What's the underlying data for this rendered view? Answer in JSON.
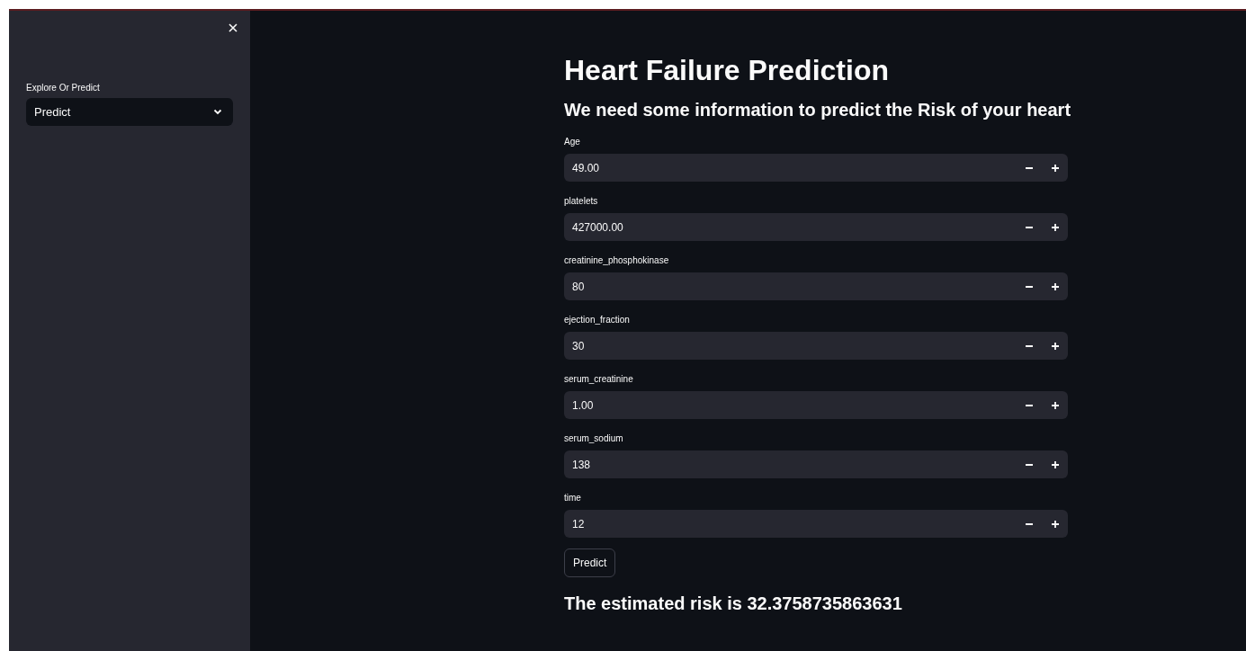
{
  "sidebar": {
    "expanded": true,
    "select": {
      "label": "Explore Or Predict",
      "value": "Predict"
    }
  },
  "main": {
    "title": "Heart Failure Prediction",
    "subtitle": "We need some information to predict the Risk of your heart",
    "fields": [
      {
        "label": "Age",
        "value": "49.00"
      },
      {
        "label": "platelets",
        "value": "427000.00"
      },
      {
        "label": "creatinine_phosphokinase",
        "value": "80"
      },
      {
        "label": "ejection_fraction",
        "value": "30"
      },
      {
        "label": "serum_creatinine",
        "value": "1.00"
      },
      {
        "label": "serum_sodium",
        "value": "138"
      },
      {
        "label": "time",
        "value": "12"
      }
    ],
    "button": "Predict",
    "result": "The estimated risk is 32.3758735863631"
  }
}
